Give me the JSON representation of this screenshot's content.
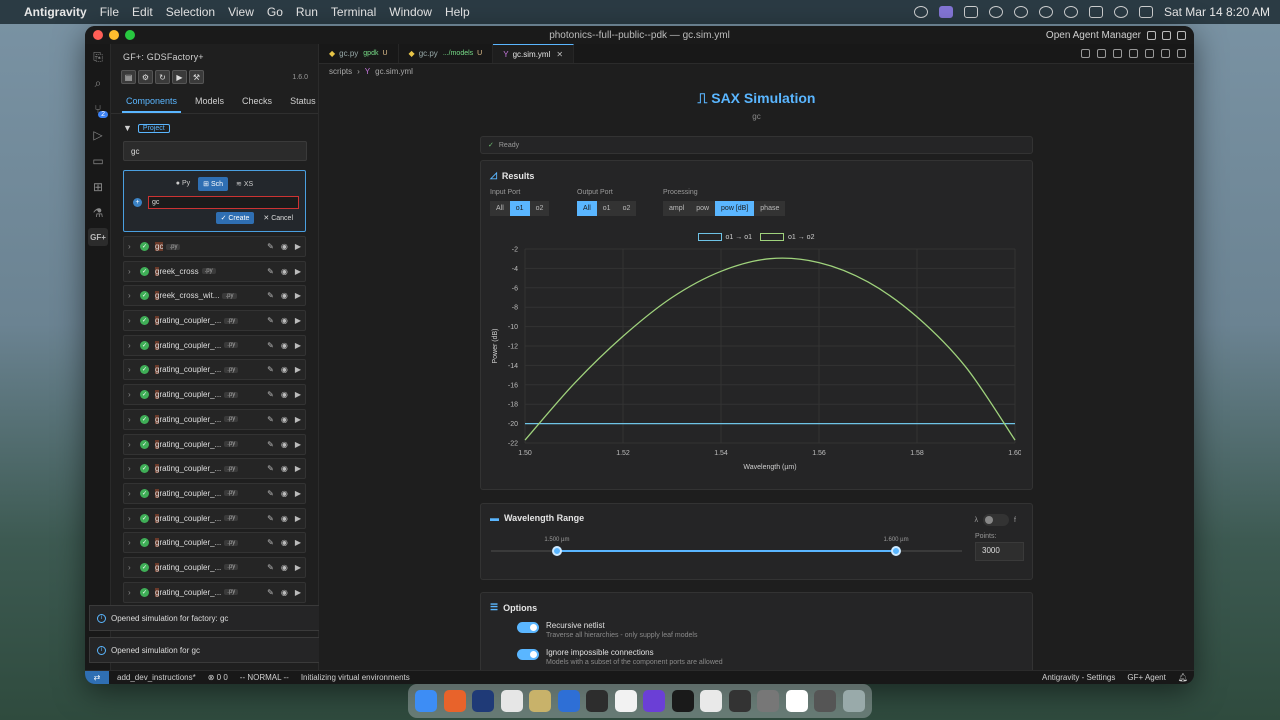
{
  "menubar": {
    "app_name": "Antigravity",
    "menus": [
      "File",
      "Edit",
      "Selection",
      "View",
      "Go",
      "Run",
      "Terminal",
      "Window",
      "Help"
    ],
    "clock": "Sat Mar 14  8:20 AM"
  },
  "window": {
    "title": "photonics--full--public--pdk — gc.sim.yml",
    "agent_manager": "Open Agent Manager"
  },
  "activity": {
    "scm_badge": "2",
    "gf_label": "GF+"
  },
  "sidebar": {
    "title": "GF+: GDSFactory+",
    "version": "1.6.0",
    "tabs": [
      "Components",
      "Models",
      "Checks",
      "Status"
    ],
    "project_badge": "Project",
    "search_value": "gc",
    "create": {
      "types": [
        "Py",
        "Sch",
        "XS"
      ],
      "name_value": "gc",
      "create_label": "Create",
      "cancel_label": "Cancel"
    },
    "components": [
      {
        "pre": "",
        "hl": "gc",
        "post": "",
        "tag": ".py"
      },
      {
        "pre": "",
        "hl": "g",
        "post": "reek_cross",
        "tag": ".py"
      },
      {
        "pre": "",
        "hl": "g",
        "post": "reek_cross_wit...",
        "tag": ".py"
      },
      {
        "pre": "",
        "hl": "g",
        "post": "rating_coupler_...",
        "tag": ".py"
      },
      {
        "pre": "",
        "hl": "g",
        "post": "rating_coupler_...",
        "tag": ".py"
      },
      {
        "pre": "",
        "hl": "g",
        "post": "rating_coupler_...",
        "tag": ".py"
      },
      {
        "pre": "",
        "hl": "g",
        "post": "rating_coupler_...",
        "tag": ".py"
      },
      {
        "pre": "",
        "hl": "g",
        "post": "rating_coupler_...",
        "tag": ".py"
      },
      {
        "pre": "",
        "hl": "g",
        "post": "rating_coupler_...",
        "tag": ".py"
      },
      {
        "pre": "",
        "hl": "g",
        "post": "rating_coupler_...",
        "tag": ".py"
      },
      {
        "pre": "",
        "hl": "g",
        "post": "rating_coupler_...",
        "tag": ".py"
      },
      {
        "pre": "",
        "hl": "g",
        "post": "rating_coupler_...",
        "tag": ".py"
      },
      {
        "pre": "",
        "hl": "g",
        "post": "rating_coupler_...",
        "tag": ".py"
      },
      {
        "pre": "",
        "hl": "g",
        "post": "rating_coupler_...",
        "tag": ".py"
      },
      {
        "pre": "",
        "hl": "g",
        "post": "rating_coupler_...",
        "tag": ".py"
      }
    ]
  },
  "toasts": [
    "Opened simulation for factory: gc",
    "Opened simulation for gc"
  ],
  "tabs": [
    {
      "name": "gc.py",
      "desc": "gpdk",
      "mod": "U"
    },
    {
      "name": "gc.py",
      "desc": ".../models",
      "mod": "U"
    },
    {
      "name": "gc.sim.yml",
      "desc": "",
      "mod": ""
    }
  ],
  "breadcrumb": [
    "scripts",
    "gc.sim.yml"
  ],
  "sim": {
    "title": "SAX Simulation",
    "subtitle": "gc",
    "status": "Ready",
    "results_title": "Results",
    "input_port": {
      "label": "Input Port",
      "options": [
        "All",
        "o1",
        "o2"
      ],
      "selected": 1
    },
    "output_port": {
      "label": "Output Port",
      "options": [
        "All",
        "o1",
        "o2"
      ],
      "selected": 0
    },
    "processing": {
      "label": "Processing",
      "options": [
        "ampl",
        "pow",
        "pow [dB]",
        "phase"
      ],
      "selected": 2
    },
    "wavelength": {
      "title": "Wavelength Range",
      "min_label": "1.500 µm",
      "max_label": "1.600 µm",
      "min": 1.5,
      "max": 1.6,
      "toggle_left": "λ",
      "toggle_right": "f",
      "points_label": "Points:",
      "points_value": "3000"
    },
    "options_title": "Options",
    "options": [
      {
        "label": "Recursive netlist",
        "desc": "Traverse all hierarchies - only supply leaf models"
      },
      {
        "label": "Ignore impossible connections",
        "desc": "Models with a subset of the component ports are allowed"
      }
    ]
  },
  "statusbar": {
    "branch": "add_dev_instructions*",
    "problems": "0  0",
    "mode": "-- NORMAL --",
    "task": "Initializing virtual environments",
    "settings": "Antigravity - Settings",
    "agent": "GF+ Agent"
  },
  "colors": {
    "accent": "#5ab6ff",
    "series_o1o1": "#6ec3e6",
    "series_o1o2": "#9fd27c"
  },
  "chart_data": {
    "type": "line",
    "title": "",
    "xlabel": "Wavelength (µm)",
    "ylabel": "Power (dB)",
    "xlim": [
      1.5,
      1.6
    ],
    "ylim": [
      -22,
      -2
    ],
    "xticks": [
      "1.50",
      "1.52",
      "1.54",
      "1.56",
      "1.58",
      "1.60"
    ],
    "yticks": [
      "-2",
      "-4",
      "-6",
      "-8",
      "-10",
      "-12",
      "-14",
      "-16",
      "-18",
      "-20",
      "-22"
    ],
    "grid": true,
    "legend": "top-center",
    "series": [
      {
        "name": "o1 → o1",
        "x": [
          1.5,
          1.52,
          1.54,
          1.56,
          1.58,
          1.6
        ],
        "y": [
          -20,
          -20,
          -20,
          -20,
          -20,
          -20
        ]
      },
      {
        "name": "o1 → o2",
        "x": [
          1.5,
          1.51,
          1.52,
          1.53,
          1.54,
          1.55,
          1.56,
          1.57,
          1.58,
          1.59,
          1.6
        ],
        "y": [
          -21.7,
          -15.9,
          -11.0,
          -7.0,
          -4.3,
          -3.0,
          -3.4,
          -5.4,
          -9.0,
          -14.2,
          -21.7
        ]
      }
    ]
  }
}
